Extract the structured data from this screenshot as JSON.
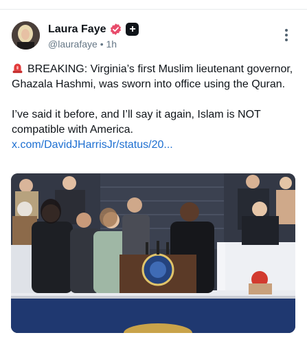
{
  "post": {
    "author": {
      "display_name": "Laura Faye",
      "handle": "@laurafaye",
      "time": "1h",
      "separator": "•"
    },
    "icons": {
      "verified": "verified-badge-icon",
      "subscriber": "plus-badge-icon",
      "alarm": "rotating-light-icon",
      "more": "more-vertical-icon"
    },
    "lines": [
      "BREAKING: Virginia’s first Muslim lieutenant governor, Ghazala Hashmi, was sworn into office using the Quran.",
      "I’ve said it before, and I’ll say it again, Islam is NOT compatible with America."
    ],
    "link": "x.com/DavidJHarrisJr/status/20...",
    "media": {
      "type": "photo",
      "subject": "swearing-in ceremony at podium with seal"
    },
    "colors": {
      "link": "#1d6fd1",
      "verified": "#e84c6b",
      "muted": "#657786"
    }
  }
}
